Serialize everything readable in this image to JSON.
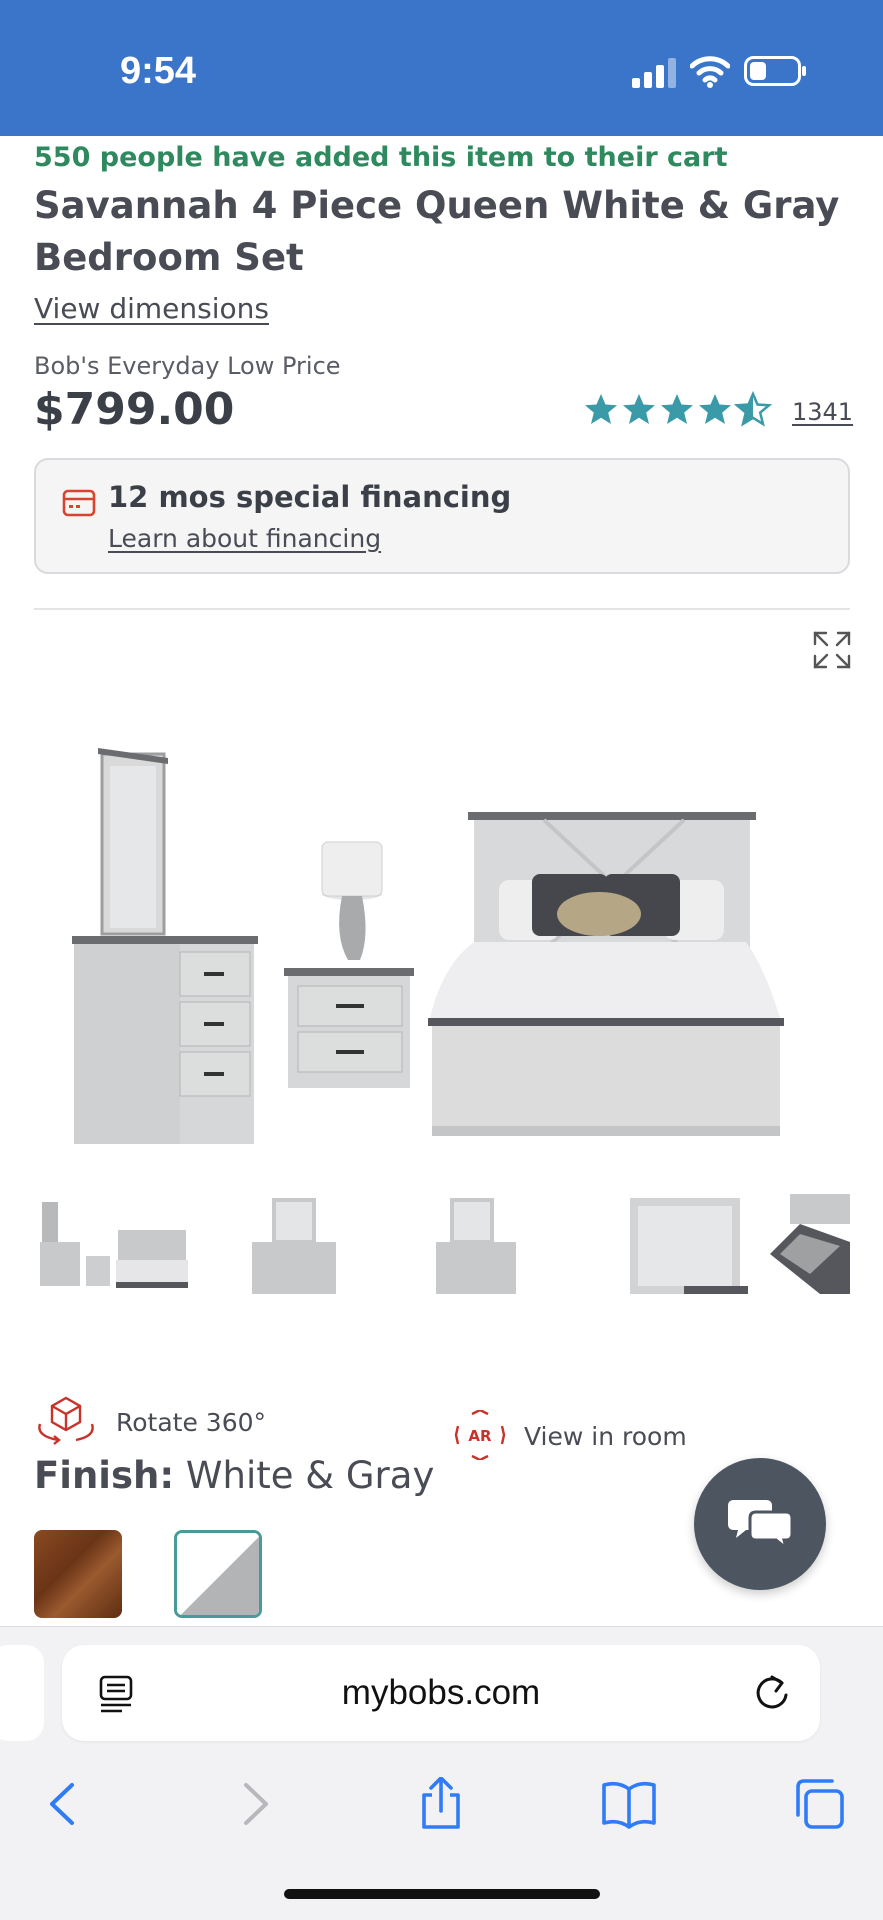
{
  "status_bar": {
    "time": "9:54",
    "icons": [
      "signal-icon",
      "wifi-icon",
      "battery-icon"
    ]
  },
  "product": {
    "cart_note": "550 people have added this item to their cart",
    "title": "Savannah 4 Piece Queen White & Gray Bedroom Set",
    "view_dimensions": "View dimensions",
    "price_label": "Bob's Everyday Low Price",
    "price": "$799.00",
    "rating": 4.5,
    "review_count": "1341"
  },
  "financing": {
    "title": "12 mos special financing",
    "link": "Learn about financing"
  },
  "gallery": {
    "active_index": 0,
    "thumbnail_count": 5
  },
  "actions": {
    "rotate_label": "Rotate 360°",
    "ar_icon_text": "AR",
    "ar_label": "View in room"
  },
  "finish": {
    "label": "Finish:",
    "value": "White & Gray",
    "swatches": [
      "wood",
      "white-gray"
    ],
    "selected": 1
  },
  "browser": {
    "url": "mybobs.com"
  },
  "colors": {
    "status_bar": "#3a75c9",
    "cart_note": "#2e8a5e",
    "star": "#3a9aa8",
    "accent_red": "#c8322b",
    "chat_button": "#4d5560",
    "ios_blue": "#2f7cf6"
  }
}
